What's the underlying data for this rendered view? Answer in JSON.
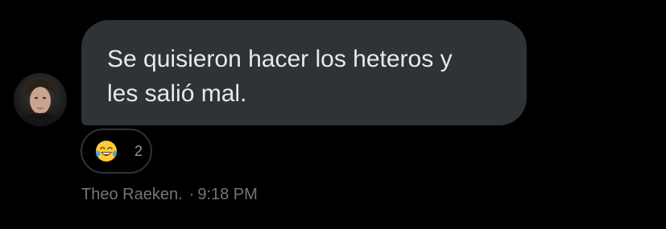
{
  "message": {
    "text": "Se quisieron hacer los heteros y\nles salió mal."
  },
  "reaction": {
    "emoji_icon": "face-with-tears-of-joy-icon",
    "count": "2"
  },
  "meta": {
    "sender": "Theo Raeken.",
    "separator": "·",
    "time": "9:18 PM"
  },
  "colors": {
    "background": "#000000",
    "bubble": "#2f3336",
    "message_text": "#e7e9ea",
    "meta_text": "#71767b",
    "emoji_yellow": "#ffcc33",
    "tear_blue": "#4aa3f0"
  }
}
